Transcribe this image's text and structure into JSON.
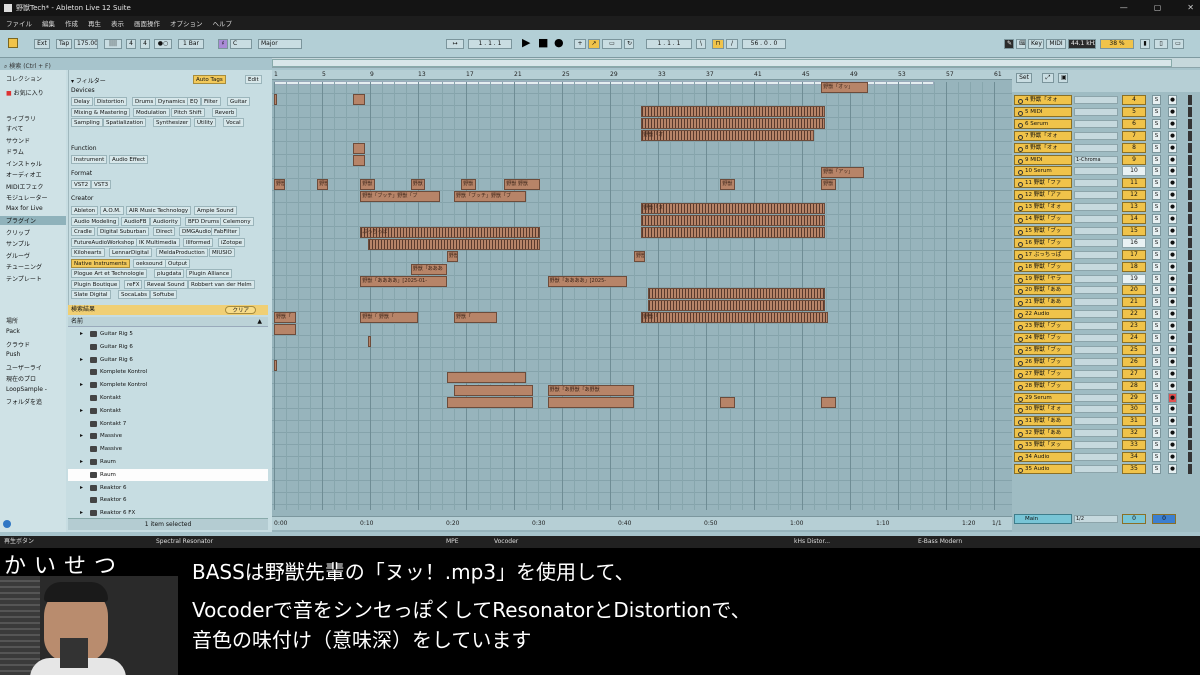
{
  "window": {
    "title": "野獣Tech* - Ableton Live 12 Suite"
  },
  "menu": [
    "ファイル",
    "編集",
    "作成",
    "再生",
    "表示",
    "画面操作",
    "オプション",
    "ヘルプ"
  ],
  "control_bar": {
    "ext": "Ext",
    "tap": "Tap",
    "tempo": "175.00",
    "sig_num": "4",
    "sig_den": "4",
    "quant": "1 Bar",
    "key": "C",
    "scale": "Major",
    "position": "1 . 1 . 1",
    "position2": "1 . 1 . 1",
    "loop_len": "56 . 0 . 0",
    "key_btn": "Key",
    "midi_btn": "MIDI",
    "sample_rate": "44.1 kHz",
    "cpu": "38 %"
  },
  "browser": {
    "search_placeholder": "検索 (Ctrl + F)",
    "collection_head": "コレクション",
    "favorites": "お気に入り",
    "library_head": "ライブラリ",
    "places": [
      "すべて",
      "サウンド",
      "ドラム",
      "インストゥル",
      "オーディオエ",
      "MIDIエフェク",
      "モジュレーター",
      "Max for Live",
      "プラグイン",
      "クリップ",
      "サンプル",
      "グルーヴ",
      "チューニング",
      "テンプレート"
    ],
    "places_selected": 8,
    "location_head": "場所",
    "locations": [
      "Pack",
      "クラウド",
      "Push",
      "ユーザーライ",
      "現在のプロ",
      "LoopSample -",
      "フォルダを追"
    ],
    "filter_label": "フィルター",
    "auto_tags": "Auto Tags",
    "edit": "Edit",
    "devices_head": "Devices",
    "function_head": "Function",
    "format_head": "Format",
    "creator_head": "Creator",
    "results_label": "検索結果",
    "clear_label": "クリア",
    "name_col": "名前",
    "footer": "1 item selected",
    "items": [
      "Guitar Rig 5",
      "Guitar Rig 6",
      "Guitar Rig 6",
      "Komplete Kontrol",
      "Komplete Kontrol",
      "Kontakt",
      "Kontakt",
      "Kontakt 7",
      "Massive",
      "Massive",
      "Raum",
      "Raum",
      "Reaktor 6",
      "Reaktor 6",
      "Reaktor 6 FX"
    ]
  },
  "tags": {
    "devices": [
      "Delay",
      "Distortion",
      "Drums",
      "Dynamics",
      "EQ",
      "Filter",
      "Guitar",
      "Mixing & Mastering",
      "Modulation",
      "Pitch Shift",
      "Reverb",
      "Sampling",
      "Spatialization",
      "Synthesizer",
      "Utility",
      "Vocal"
    ],
    "function": [
      "Instrument",
      "Audio Effect"
    ],
    "format": [
      "VST2",
      "VST3"
    ],
    "creator": [
      "Ableton",
      "A.O.M.",
      "AIR Music Technology",
      "Ampie Sound",
      "Audio Modeling",
      "AudioFB",
      "Audiority",
      "BFD Drums",
      "Celemony",
      "Cradle",
      "Digital Suburban",
      "Direct",
      "DMGAudio",
      "FabFilter",
      "FutureAudioWorkshop",
      "IK Multimedia",
      "Illformed",
      "iZotope",
      "Kilohearts",
      "LennarDigital",
      "MeldaProduction",
      "MIUSIO",
      "Native Instruments",
      "oeksound",
      "Output",
      "Plogue Art et Technologie",
      "plugdata",
      "Plugin Alliance",
      "Plugin Boutique",
      "reFX",
      "Reveal Sound",
      "Robbert van der Helm",
      "Slate Digital",
      "SocaLabs",
      "Softube"
    ]
  },
  "arrangement": {
    "bar_labels": [
      "1",
      "5",
      "9",
      "13",
      "17",
      "21",
      "25",
      "29",
      "33",
      "37",
      "41",
      "45",
      "49",
      "53",
      "57",
      "61"
    ],
    "time_labels": [
      "0:00",
      "0:10",
      "0:20",
      "0:30",
      "0:40",
      "0:50",
      "1:00",
      "1:10",
      "1:20"
    ],
    "page": "1/1"
  },
  "clips": [
    {
      "row": 0,
      "s": 0.76,
      "w": 0.065,
      "t": "野獣「オッ」"
    },
    {
      "row": 1,
      "s": 0.0,
      "w": 0.004,
      "t": ""
    },
    {
      "row": 1,
      "s": 0.11,
      "w": 0.016,
      "t": ""
    },
    {
      "row": 2,
      "s": 0.51,
      "w": 0.255,
      "t": ""
    },
    {
      "row": 3,
      "s": 0.51,
      "w": 0.255,
      "t": ""
    },
    {
      "row": 4,
      "s": 0.51,
      "w": 0.24,
      "t": "野獣「オ"
    },
    {
      "row": 5,
      "s": 0.11,
      "w": 0.016,
      "t": ""
    },
    {
      "row": 6,
      "s": 0.11,
      "w": 0.016,
      "t": ""
    },
    {
      "row": 7,
      "s": 0.76,
      "w": 0.06,
      "t": "野獣「アッ」"
    },
    {
      "row": 8,
      "s": 0.0,
      "w": 0.015,
      "t": "野獣"
    },
    {
      "row": 8,
      "s": 0.06,
      "w": 0.015,
      "t": "野獣"
    },
    {
      "row": 8,
      "s": 0.12,
      "w": 0.02,
      "t": "野獣"
    },
    {
      "row": 8,
      "s": 0.19,
      "w": 0.02,
      "t": "野獣"
    },
    {
      "row": 8,
      "s": 0.26,
      "w": 0.02,
      "t": "野獣"
    },
    {
      "row": 8,
      "s": 0.32,
      "w": 0.05,
      "t": "野獣 野獣"
    },
    {
      "row": 8,
      "s": 0.62,
      "w": 0.02,
      "t": "野獣"
    },
    {
      "row": 8,
      "s": 0.76,
      "w": 0.02,
      "t": "野獣"
    },
    {
      "row": 9,
      "s": 0.12,
      "w": 0.11,
      "t": "野獣「ブッチ」野獣「ブ"
    },
    {
      "row": 9,
      "s": 0.25,
      "w": 0.1,
      "t": "野獣「ブッチ」野獣「ブ"
    },
    {
      "row": 10,
      "s": 0.51,
      "w": 0.255,
      "t": "野獣「ヌ"
    },
    {
      "row": 11,
      "s": 0.51,
      "w": 0.255,
      "t": ""
    },
    {
      "row": 12,
      "s": 0.12,
      "w": 0.25,
      "t": "ぶっちっぱ"
    },
    {
      "row": 12,
      "s": 0.51,
      "w": 0.255,
      "t": ""
    },
    {
      "row": 13,
      "s": 0.13,
      "w": 0.24,
      "t": ""
    },
    {
      "row": 14,
      "s": 0.24,
      "w": 0.015,
      "t": "野獣"
    },
    {
      "row": 14,
      "s": 0.5,
      "w": 0.015,
      "t": "野獣"
    },
    {
      "row": 15,
      "s": 0.19,
      "w": 0.05,
      "t": "野獣「あああ"
    },
    {
      "row": 16,
      "s": 0.12,
      "w": 0.12,
      "t": "野獣「ああああ」[2025-01-"
    },
    {
      "row": 16,
      "s": 0.38,
      "w": 0.11,
      "t": "野獣「ああああ」[2025-"
    },
    {
      "row": 17,
      "s": 0.52,
      "w": 0.245,
      "t": ""
    },
    {
      "row": 18,
      "s": 0.52,
      "w": 0.245,
      "t": ""
    },
    {
      "row": 19,
      "s": 0.0,
      "w": 0.03,
      "t": "野獣「"
    },
    {
      "row": 19,
      "s": 0.12,
      "w": 0.08,
      "t": "野獣「 野獣「"
    },
    {
      "row": 19,
      "s": 0.25,
      "w": 0.06,
      "t": "野獣「"
    },
    {
      "row": 19,
      "s": 0.51,
      "w": 0.26,
      "t": "野獣「"
    },
    {
      "row": 20,
      "s": 0.0,
      "w": 0.03,
      "t": ""
    },
    {
      "row": 21,
      "s": 0.13,
      "w": 0.005,
      "t": ""
    },
    {
      "row": 23,
      "s": 0.0,
      "w": 0.003,
      "t": ""
    },
    {
      "row": 24,
      "s": 0.24,
      "w": 0.11,
      "t": ""
    },
    {
      "row": 25,
      "s": 0.25,
      "w": 0.11,
      "t": ""
    },
    {
      "row": 25,
      "s": 0.38,
      "w": 0.12,
      "t": "野獣「あ野獣「あ野獣"
    },
    {
      "row": 26,
      "s": 0.24,
      "w": 0.12,
      "t": ""
    },
    {
      "row": 26,
      "s": 0.38,
      "w": 0.12,
      "t": ""
    },
    {
      "row": 26,
      "s": 0.62,
      "w": 0.02,
      "t": ""
    },
    {
      "row": 26,
      "s": 0.76,
      "w": 0.02,
      "t": ""
    }
  ],
  "tracks": [
    {
      "name": "4 野獣「オォ",
      "num": "4",
      "slot": ""
    },
    {
      "name": "5 MIDI",
      "num": "5",
      "slot": ""
    },
    {
      "name": "6 Serum",
      "num": "6",
      "slot": ""
    },
    {
      "name": "7 野獣「オォ",
      "num": "7",
      "slot": ""
    },
    {
      "name": "8 野獣「オォ",
      "num": "8",
      "slot": ""
    },
    {
      "name": "9 MIDI",
      "num": "9",
      "slot": "1-Chroma"
    },
    {
      "name": "10 Serum",
      "num": "10",
      "slot": ""
    },
    {
      "name": "11 野獣「ファ",
      "num": "11",
      "slot": ""
    },
    {
      "name": "12 野獣「アァ",
      "num": "12",
      "slot": ""
    },
    {
      "name": "13 野獣「オォ",
      "num": "13",
      "slot": ""
    },
    {
      "name": "14 野獣「ブッ",
      "num": "14",
      "slot": ""
    },
    {
      "name": "15 野獣「ブッ",
      "num": "15",
      "slot": ""
    },
    {
      "name": "16 野獣「ブッ",
      "num": "16",
      "slot": ""
    },
    {
      "name": "17 ぶっちっぱ",
      "num": "17",
      "slot": ""
    },
    {
      "name": "18 野獣「ブッ",
      "num": "18",
      "slot": ""
    },
    {
      "name": "19 野獣「ヤラ",
      "num": "19",
      "slot": ""
    },
    {
      "name": "20 野獣「ああ",
      "num": "20",
      "slot": ""
    },
    {
      "name": "21 野獣「ああ",
      "num": "21",
      "slot": ""
    },
    {
      "name": "22 Audio",
      "num": "22",
      "slot": ""
    },
    {
      "name": "23 野獣「ブッ",
      "num": "23",
      "slot": ""
    },
    {
      "name": "24 野獣「ブッ",
      "num": "24",
      "slot": ""
    },
    {
      "name": "25 野獣「ブッ",
      "num": "25",
      "slot": ""
    },
    {
      "name": "26 野獣「ブッ",
      "num": "26",
      "slot": ""
    },
    {
      "name": "27 野獣「ブッ",
      "num": "27",
      "slot": ""
    },
    {
      "name": "28 野獣「ブッ",
      "num": "28",
      "slot": ""
    },
    {
      "name": "29 Serum",
      "num": "29",
      "slot": ""
    },
    {
      "name": "30 野獣「オォ",
      "num": "30",
      "slot": ""
    },
    {
      "name": "31 野獣「ああ",
      "num": "31",
      "slot": ""
    },
    {
      "name": "32 野獣「ああ",
      "num": "32",
      "slot": ""
    },
    {
      "name": "33 野獣「ヌッ",
      "num": "33",
      "slot": ""
    },
    {
      "name": "34 Audio",
      "num": "34",
      "slot": ""
    },
    {
      "name": "35 Audio",
      "num": "35",
      "slot": ""
    }
  ],
  "main_track": {
    "name": "Main",
    "slot": "1/2",
    "num": "0",
    "num2": "0"
  },
  "status": {
    "left": "再生ボタン",
    "d1": "Spectral Resonator",
    "d2": "MPE",
    "d3": "Vocoder",
    "d4": "kHs Distor...",
    "d5": "E-Bass Modern"
  },
  "caption": {
    "title": "かいせつ",
    "line1": "BASSは野獣先輩の「ヌッ！.mp3」を使用して、",
    "line2": "Vocoderで音をシンセっぽくしてResonatorとDistortionで、",
    "line3": "音色の味付け（意味深）をしています"
  }
}
